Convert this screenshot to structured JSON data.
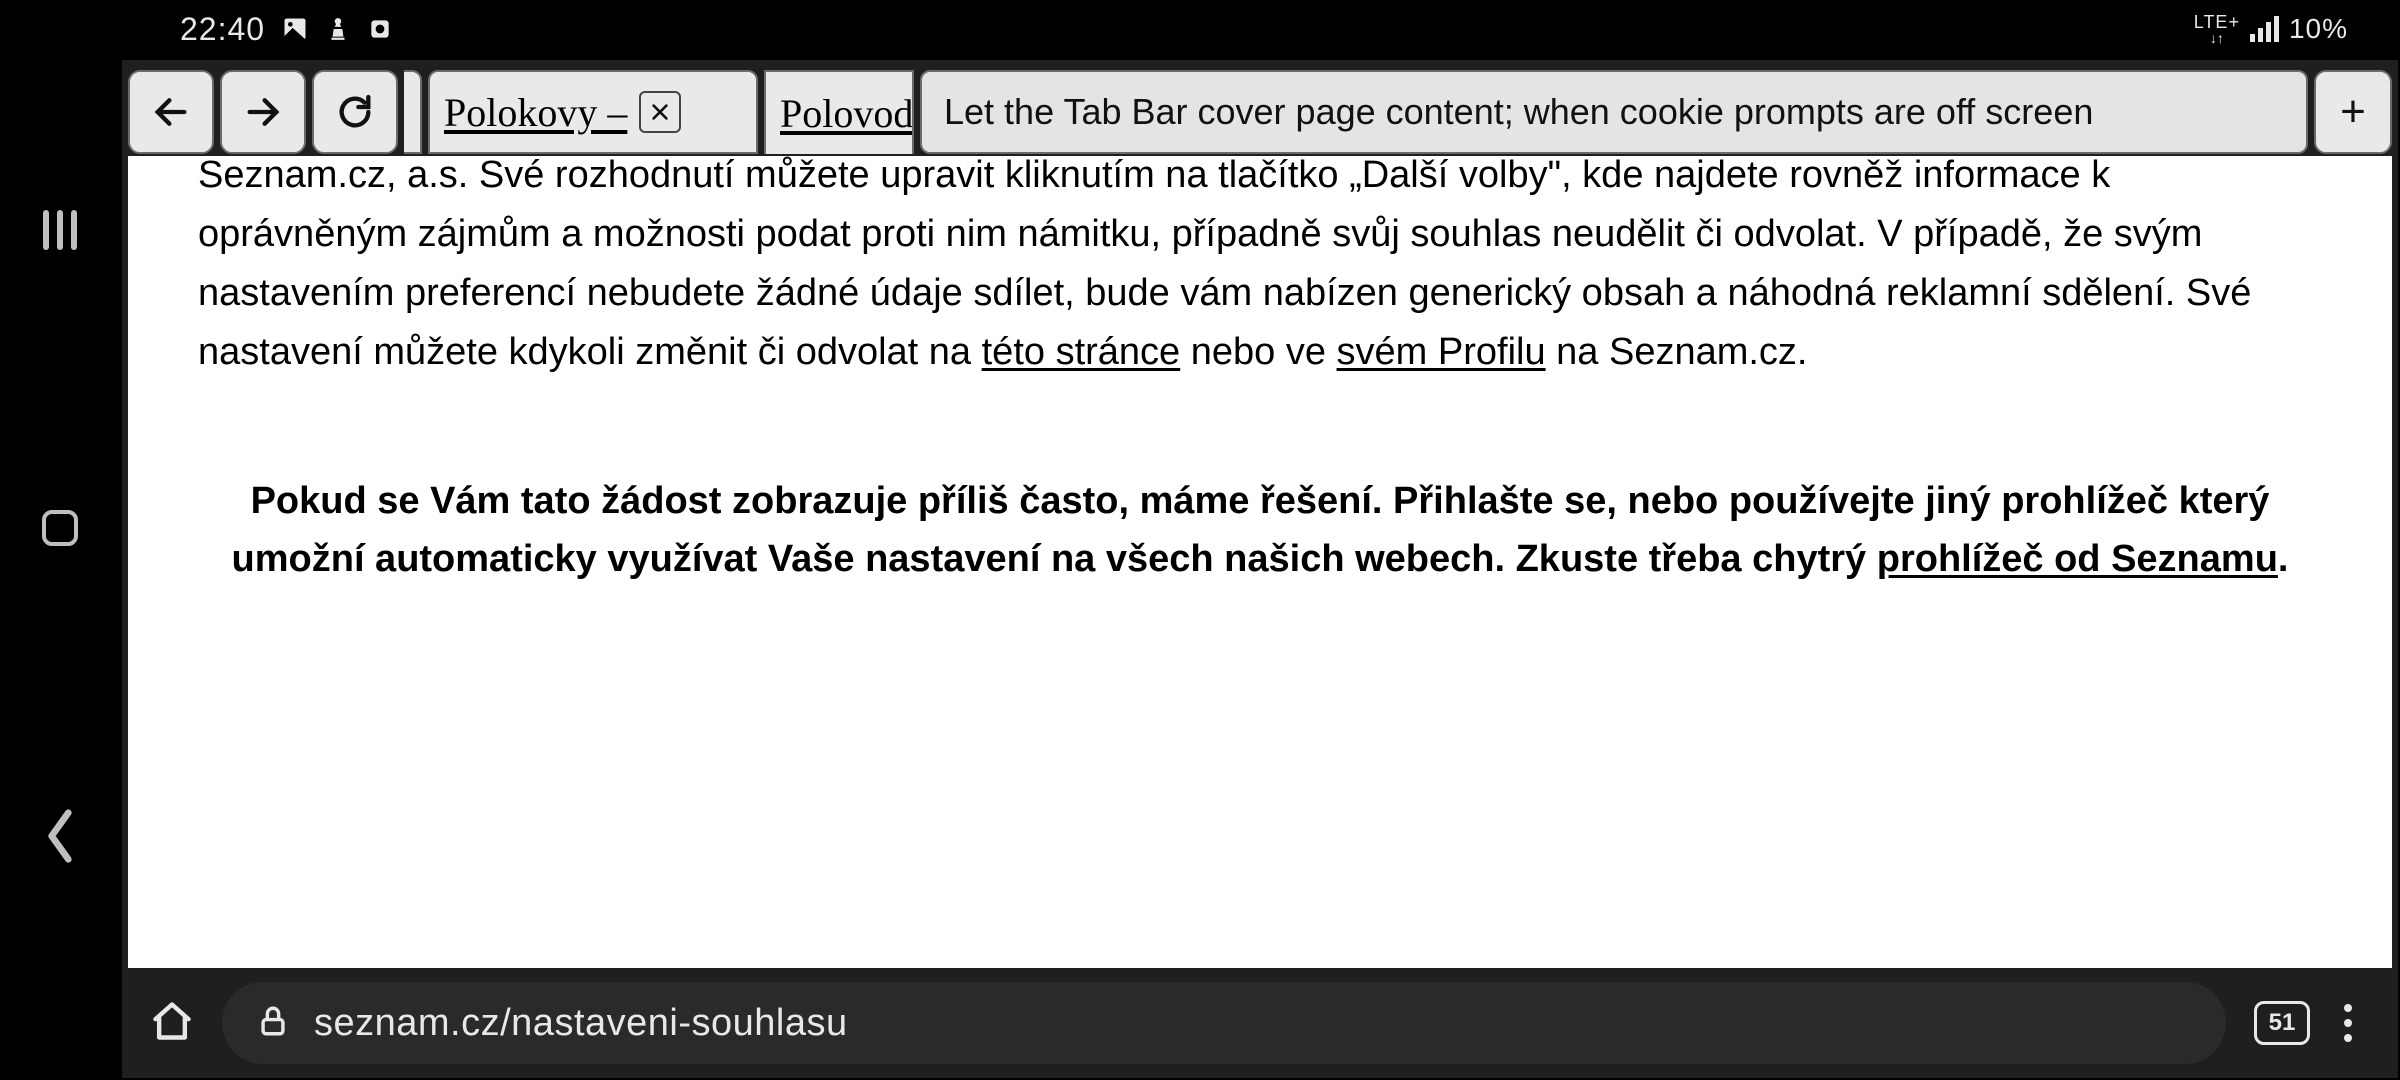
{
  "status": {
    "time": "22:40",
    "network_label": "LTE+",
    "battery_pct": "10%"
  },
  "tabbar": {
    "tabs": [
      {
        "title": "Polokovy –"
      },
      {
        "title": "Polovod"
      }
    ],
    "hint": "Let the Tab Bar cover page content; when cookie prompts are off screen",
    "new_tab_label": "+"
  },
  "page": {
    "para_pre": "Seznam.cz, a.s. Své rozhodnutí můžete upravit kliknutím na tlačítko „Další volby\", kde najdete rovněž informace k oprávněným zájmům a možnosti podat proti nim námitku, případně svůj souhlas neudělit či odvolat. V případě, že svým nastavením preferencí nebudete žádné údaje sdílet, bude vám nabízen generický obsah a náhodná reklamní sdělení. Své nastavení můžete kdykoli změnit či odvolat na ",
    "link1": "této stránce",
    "para_mid": " nebo ve ",
    "link2": "svém Profilu",
    "para_post": " na Seznam.cz.",
    "bold_pre": "Pokud se Vám tato žádost zobrazuje příliš často, máme řešení. Přihlašte se, nebo používejte jiný prohlížeč který umožní automaticky využívat Vaše nastavení na všech našich webech. Zkuste třeba chytrý ",
    "bold_link": "prohlížeč od Seznamu",
    "bold_post": "."
  },
  "bottom": {
    "url": "seznam.cz/nastaveni-souhlasu",
    "tab_count": "51"
  }
}
